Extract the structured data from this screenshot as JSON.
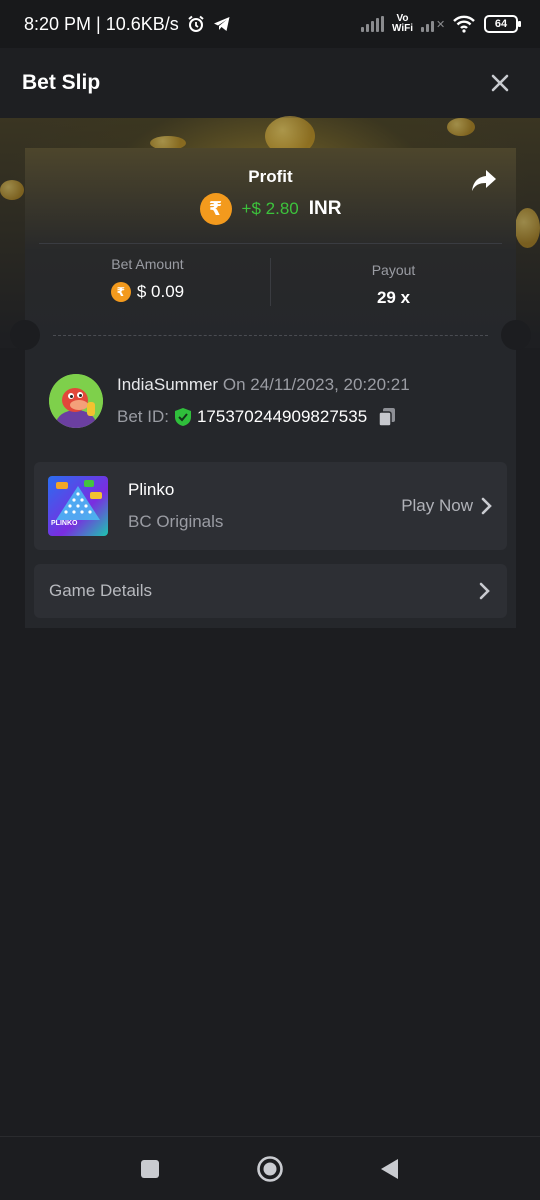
{
  "status_bar": {
    "time_speed": "8:20 PM | 10.6KB/s",
    "network_label_top": "Vo",
    "network_label_bottom": "WiFi",
    "battery": "64"
  },
  "header": {
    "title": "Bet Slip"
  },
  "summary": {
    "profit_label": "Profit",
    "currency_symbol": "₹",
    "profit_value": "+$ 2.80",
    "profit_currency": "INR",
    "bet_amount_label": "Bet Amount",
    "bet_amount_value": "$ 0.09",
    "payout_label": "Payout",
    "payout_value": "29 x"
  },
  "user": {
    "name": "IndiaSummer",
    "date_text": "On 24/11/2023, 20:20:21",
    "bet_id_label": "Bet ID:",
    "bet_id": "175370244909827535"
  },
  "game": {
    "name": "Plinko",
    "provider": "BC Originals",
    "thumb_text": "PLINKO",
    "play_label": "Play Now"
  },
  "details": {
    "label": "Game Details"
  },
  "colors": {
    "profit_green": "#3cc23c",
    "rupee_orange": "#f39a1d",
    "background": "#1c1d20",
    "card": "#25272b"
  }
}
